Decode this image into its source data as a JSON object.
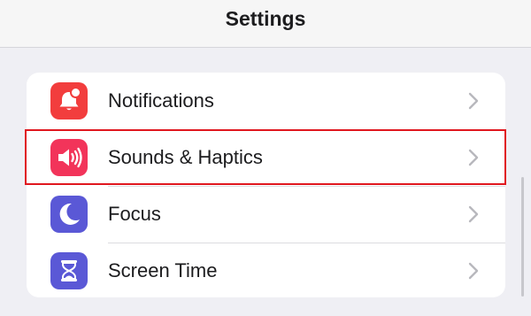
{
  "header": {
    "title": "Settings"
  },
  "settings_items": [
    {
      "label": "Notifications",
      "icon": "notifications-bell-icon",
      "color": "#f23d3d"
    },
    {
      "label": "Sounds & Haptics",
      "icon": "speaker-icon",
      "color": "#f2345a"
    },
    {
      "label": "Focus",
      "icon": "moon-icon",
      "color": "#5a58d6"
    },
    {
      "label": "Screen Time",
      "icon": "hourglass-icon",
      "color": "#5a58d6"
    }
  ],
  "highlighted_item": "Sounds & Haptics",
  "colors": {
    "background": "#efeff4",
    "highlight_border": "#e0171f"
  }
}
